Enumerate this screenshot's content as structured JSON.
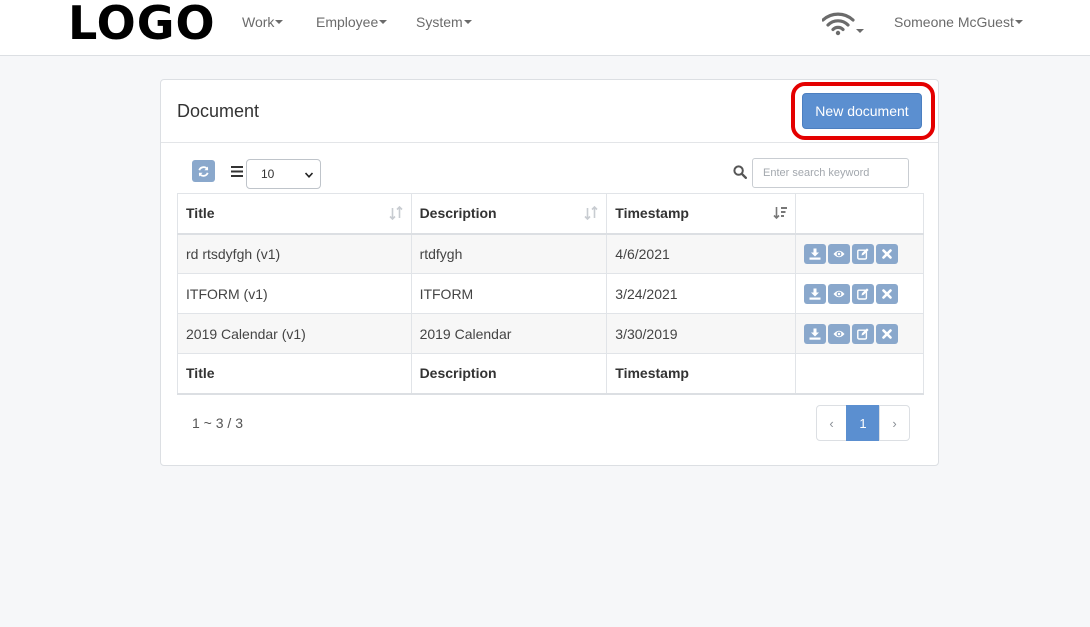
{
  "navbar": {
    "logo": "LOGO",
    "menu": [
      {
        "label": "Work"
      },
      {
        "label": "Employee"
      },
      {
        "label": "System"
      }
    ],
    "user": "Someone McGuest"
  },
  "panel": {
    "title": "Document",
    "new_button": "New document"
  },
  "toolbar": {
    "page_size": "10",
    "search_placeholder": "Enter search keyword"
  },
  "table": {
    "columns": [
      "Title",
      "Description",
      "Timestamp"
    ],
    "rows": [
      {
        "title": "rd rtsdyfgh (v1)",
        "description": "rtdfygh",
        "timestamp": "4/6/2021"
      },
      {
        "title": "ITFORM (v1)",
        "description": "ITFORM",
        "timestamp": "3/24/2021"
      },
      {
        "title": "2019 Calendar (v1)",
        "description": "2019 Calendar",
        "timestamp": "3/30/2019"
      }
    ]
  },
  "pagination": {
    "summary": "1 ~ 3 / 3",
    "prev": "‹",
    "current": "1",
    "next": "›"
  },
  "colors": {
    "accent": "#5b8fd0",
    "action_button": "#8aa8cc",
    "highlight": "#e40000"
  },
  "icons": [
    "refresh-icon",
    "list-icon",
    "search-icon",
    "sort-icon",
    "download-icon",
    "eye-icon",
    "edit-icon",
    "close-icon",
    "wifi-icon",
    "caret-down-icon"
  ]
}
